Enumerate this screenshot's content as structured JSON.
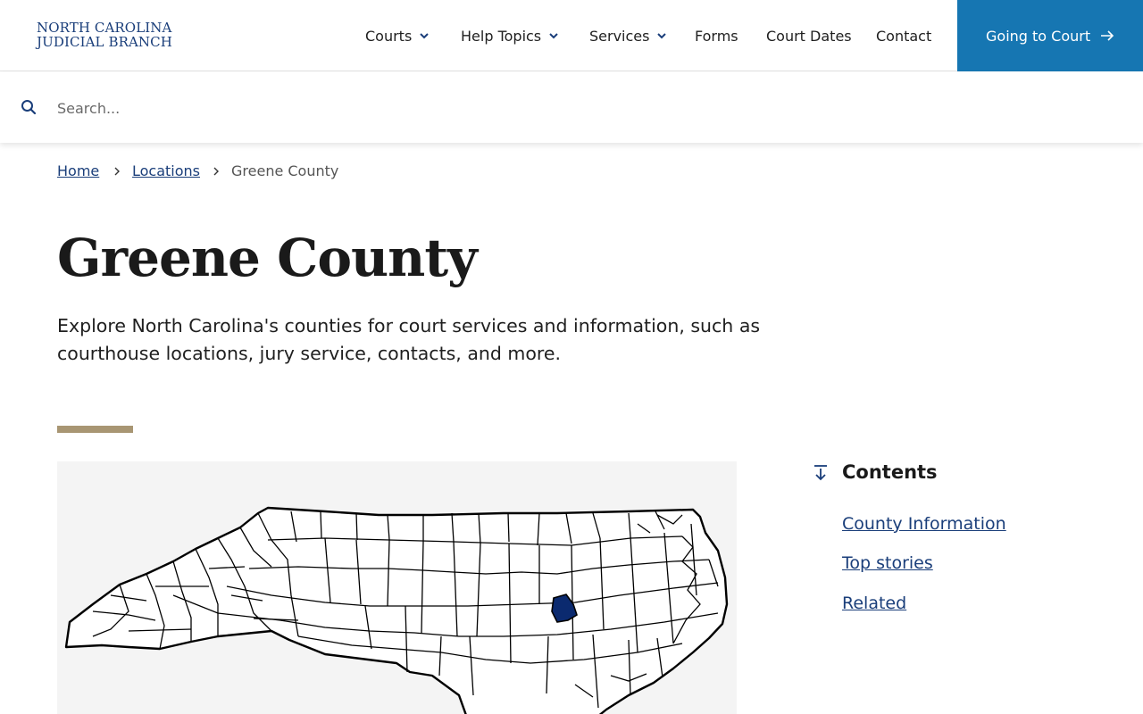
{
  "header": {
    "logo_line1": "NORTH CAROLINA",
    "logo_line2": "JUDICIAL BRANCH",
    "nav": {
      "courts": "Courts",
      "help_topics": "Help Topics",
      "services": "Services",
      "forms": "Forms",
      "court_dates": "Court Dates",
      "contact": "Contact"
    },
    "cta_label": "Going to Court"
  },
  "search": {
    "placeholder": "Search..."
  },
  "breadcrumb": {
    "home": "Home",
    "locations": "Locations",
    "current": "Greene County"
  },
  "page": {
    "title": "Greene County",
    "lead": "Explore North Carolina's counties for court services and information, such as courthouse locations, jury service, contacts, and more."
  },
  "map": {
    "highlighted_county": "Greene",
    "highlight_color": "#0b2a6f"
  },
  "contents": {
    "title": "Contents",
    "items": [
      "County Information",
      "Top stories",
      "Related"
    ]
  },
  "colors": {
    "brand": "#1a3e7a",
    "cta": "#1676b2",
    "accent": "#a89673"
  }
}
